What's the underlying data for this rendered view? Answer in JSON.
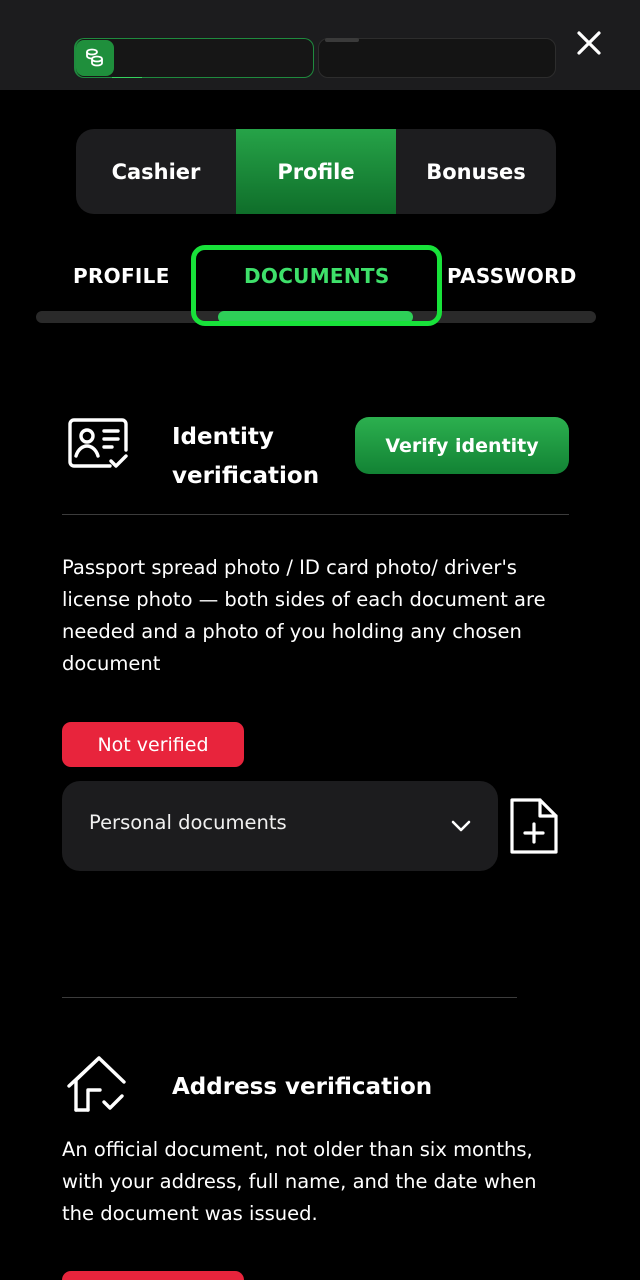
{
  "header": {
    "coin_icon": "coin-stack-icon",
    "close_icon": "close-icon"
  },
  "main_tabs": [
    {
      "label": "Cashier",
      "active": false
    },
    {
      "label": "Profile",
      "active": true
    },
    {
      "label": "Bonuses",
      "active": false
    }
  ],
  "sub_tabs": [
    {
      "label": "PROFILE",
      "active": false
    },
    {
      "label": "DOCUMENTS",
      "active": true
    },
    {
      "label": "PASSWORD",
      "active": false
    }
  ],
  "identity": {
    "icon": "id-card-check-icon",
    "title": "Identity verification",
    "verify_button": "Verify identity",
    "description": "Passport spread photo / ID card photo/ driver's license photo — both sides of each document are needed and a photo of you holding any chosen document",
    "status": "Not verified",
    "select_value": "Personal documents",
    "add_file_icon": "add-file-icon"
  },
  "address": {
    "icon": "home-check-icon",
    "title": "Address verification",
    "description": "An official document, not older than six months, with your address, full name, and the date when the document was issued."
  },
  "colors": {
    "accent_green": "#2ecf58",
    "highlight_green": "#18e23a",
    "status_red": "#e8243c",
    "panel": "#1c1c1e"
  }
}
